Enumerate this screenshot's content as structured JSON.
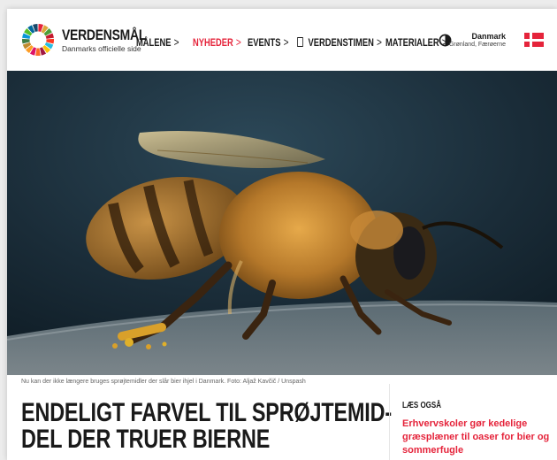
{
  "brand": {
    "name": "VERDENSMÅL",
    "subtitle": "Danmarks officielle side"
  },
  "nav": {
    "items": [
      {
        "label": "MÅLENE",
        "chevron": ">"
      },
      {
        "label": "NYHEDER",
        "chevron": ">",
        "active": true
      },
      {
        "label": "EVENTS",
        "chevron": ">"
      },
      {
        "label": "VERDENSTIMEN",
        "chevron": ">"
      },
      {
        "label": "MATERIALER",
        "chevron": ">"
      }
    ]
  },
  "country": {
    "main": "Danmark",
    "sub": "Grønland, Færøerne"
  },
  "hero": {
    "caption": "Nu kan der ikke længere bruges sprøjtemidler der slår bier ihjel i Danmark. Foto: Aljaž Kavčič / Unspash"
  },
  "article": {
    "headline_line1": "ENDELIGT FARVEL TIL SPRØJTEMID-",
    "headline_line2": "DEL DER TRUER BIERNE"
  },
  "aside": {
    "title": "LÆS OGSÅ",
    "link": "Erhvervskoler gør kedelige græsplæner til oaser for bier og sommerfugle"
  },
  "colors": {
    "accent": "#e5243b",
    "text": "#1a1a1a"
  },
  "icons": [
    "sdg-wheel-logo-icon",
    "chevron-right-icon",
    "book-icon",
    "contrast-icon",
    "danish-flag-icon"
  ]
}
